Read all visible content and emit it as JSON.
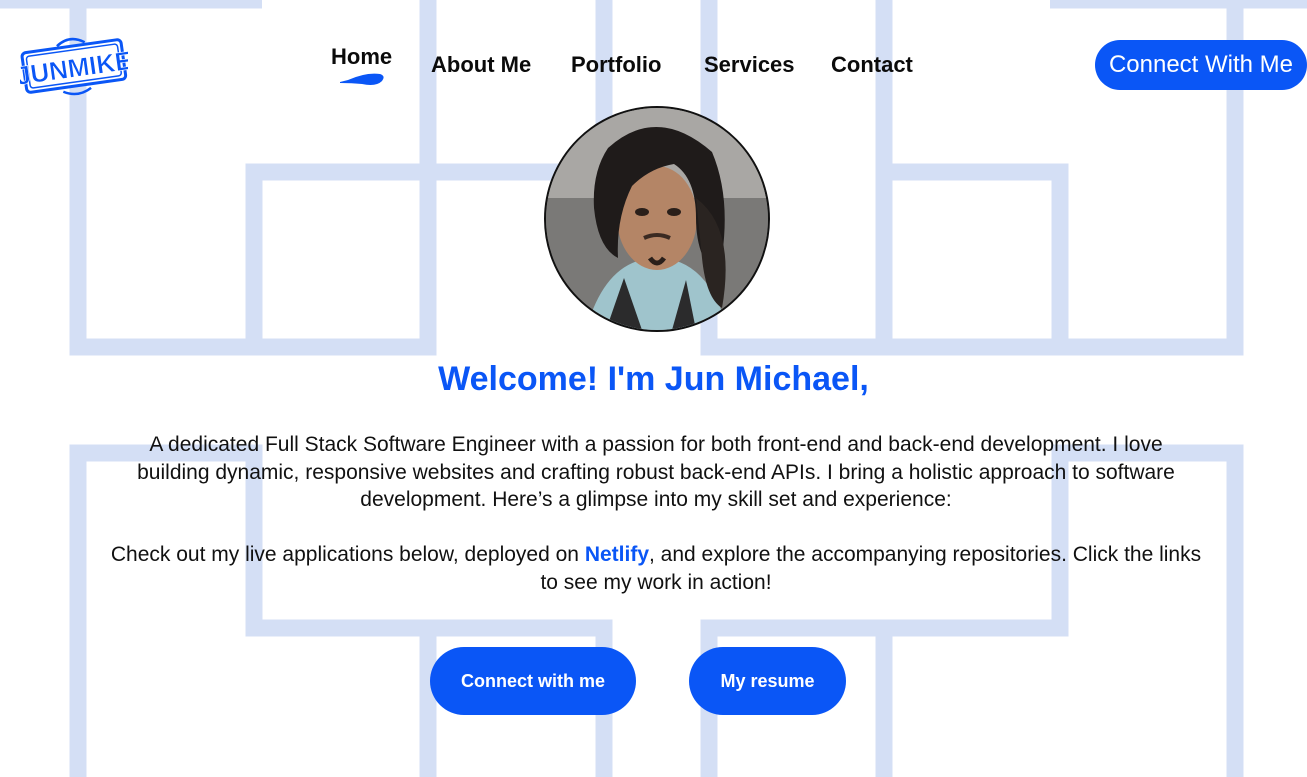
{
  "brand": {
    "logo_text": "JUNMIKE"
  },
  "nav": {
    "items": [
      {
        "label": "Home",
        "active": true
      },
      {
        "label": "About Me"
      },
      {
        "label": "Portfolio"
      },
      {
        "label": "Services"
      },
      {
        "label": "Contact"
      }
    ],
    "cta_label": "Connect With Me"
  },
  "hero": {
    "title": "Welcome! I'm Jun Michael,",
    "intro": "A dedicated Full Stack Software Engineer with a passion for both front-end and back-end development. I love building dynamic, responsive websites and crafting robust back-end APIs. I bring a holistic approach to software development. Here’s a glimpse into my skill set and experience:",
    "cta_before": "Check out my live applications below, deployed on ",
    "cta_link": "Netlify",
    "cta_after": ", and explore the accompanying repositories. Click the links to see my work in action!",
    "buttons": {
      "connect": "Connect with me",
      "resume": "My resume"
    }
  },
  "colors": {
    "accent": "#0a56f6",
    "background_pattern": "#d4dff5",
    "text": "#111111",
    "background": "#ffffff"
  },
  "icons": {
    "home_underline": "brush-stroke-icon",
    "avatar": "profile-photo"
  }
}
